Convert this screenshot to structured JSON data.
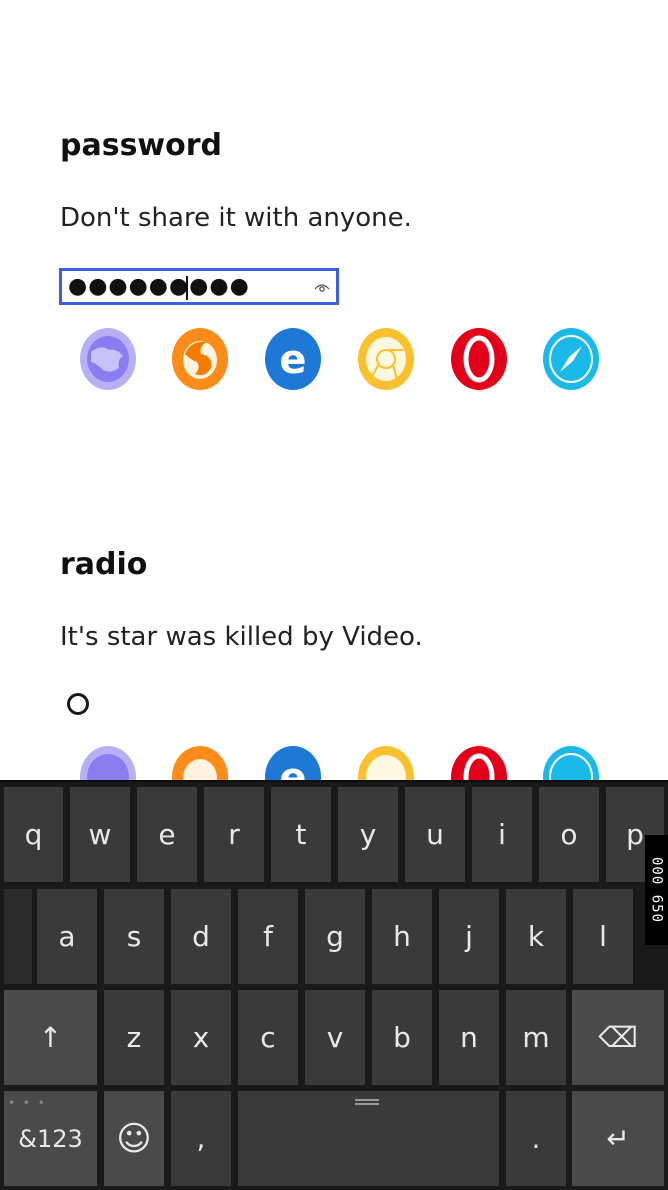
{
  "password_section": {
    "title": "password",
    "description": "Don't share it with anyone.",
    "value_masked": "●●●●●●●●●"
  },
  "radio_section": {
    "title": "radio",
    "description": "It's star was killed by Video."
  },
  "browsers": [
    "ie-icon",
    "firefox-icon",
    "edge-icon",
    "chrome-icon",
    "opera-icon",
    "safari-icon"
  ],
  "keyboard": {
    "row1": [
      "q",
      "w",
      "e",
      "r",
      "t",
      "y",
      "u",
      "i",
      "o",
      "p"
    ],
    "row2": [
      "a",
      "s",
      "d",
      "f",
      "g",
      "h",
      "j",
      "k",
      "l"
    ],
    "row3": [
      "z",
      "x",
      "c",
      "v",
      "b",
      "n",
      "m"
    ],
    "shift": "↑",
    "backspace": "⌫",
    "symbols": "&123",
    "emoji": "☺",
    "comma": ",",
    "period": ".",
    "enter": "↵",
    "side_badge": "000 650"
  },
  "colors": {
    "focus_border": "#3d5fe0",
    "ie": "#8a7df0",
    "firefox": "#f57c00",
    "edge": "#1e78d6",
    "chrome": "#fbc02d",
    "opera": "#e3001b",
    "safari": "#1bb9e8"
  }
}
